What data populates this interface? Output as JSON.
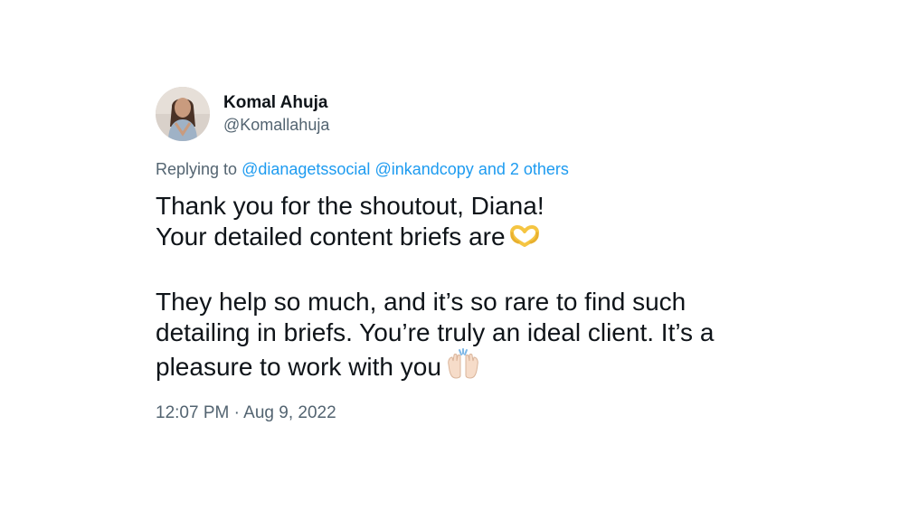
{
  "author": {
    "display_name": "Komal Ahuja",
    "handle": "@Komallahuja",
    "avatar_icon": "profile-photo"
  },
  "reply": {
    "prefix": "Replying to",
    "mention_1": "@dianagetssocial",
    "mention_2": "@inkandcopy",
    "others": "and 2 others"
  },
  "body": {
    "line_1": "Thank you for the shoutout, Diana!",
    "line_2": "Your detailed content briefs are",
    "line_2_emoji": "heart-hands-emoji",
    "line_3": "They help so much, and it’s so rare to find such",
    "line_4": "detailing in briefs. You’re truly an ideal client. It’s a",
    "line_5": "pleasure to work with you",
    "line_5_emoji": "raising-hands-emoji"
  },
  "timestamp": "12:07 PM · Aug 9, 2022",
  "colors": {
    "link": "#1d9bf0",
    "secondary_text": "#536471",
    "primary_text": "#0f1419",
    "background": "#ffffff"
  }
}
